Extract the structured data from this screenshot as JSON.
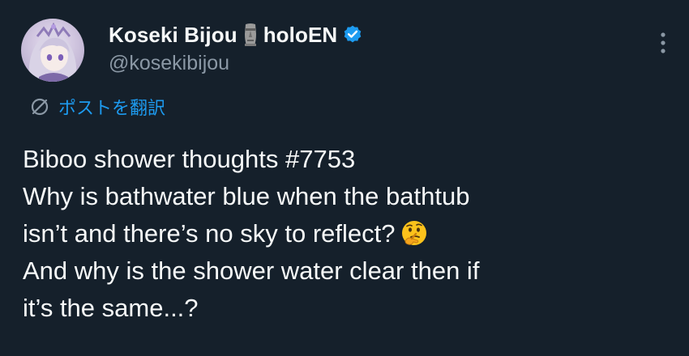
{
  "post": {
    "author": {
      "display_name": "Koseki Bijou",
      "name_emoji_icon": "moai-icon",
      "name_suffix": "holoEN",
      "handle": "@kosekibijou",
      "verified_icon": "verified-badge-icon"
    },
    "translate_label": "ポストを翻訳",
    "text_lines": [
      "Biboo shower thoughts #7753",
      "Why is bathwater blue when the bathtub",
      "isn’t and there’s no sky to reflect?",
      "And why is the shower water clear then if",
      "it’s the same...?"
    ],
    "inline_emoji_icon": "thinking-face-icon"
  },
  "colors": {
    "background": "#15202b",
    "text": "#f7f9f9",
    "secondary_text": "#8b98a5",
    "link": "#1d9bf0",
    "verified": "#1d9bf0"
  }
}
